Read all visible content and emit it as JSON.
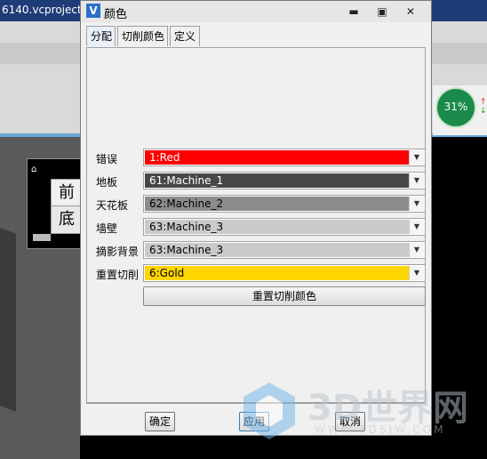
{
  "background": {
    "project_title": "6140.vcproject (",
    "nav_cube": {
      "top_face": "前",
      "bottom_face": "底"
    },
    "gauge_percent": "31%",
    "arrow_up": "↑",
    "arrow_down": "↓"
  },
  "dialog": {
    "icon": "V",
    "title": "颜色",
    "window_buttons": {
      "minimize": "▬",
      "maximize": "▣",
      "close": "✕"
    },
    "tabs": [
      {
        "label": "分配",
        "active": true
      },
      {
        "label": "切削颜色",
        "active": false
      },
      {
        "label": "定义",
        "active": false
      }
    ],
    "rows": [
      {
        "label": "错误",
        "value": "1:Red",
        "color": "#ff0000",
        "text_color": "#ffffff"
      },
      {
        "label": "地板",
        "value": "61:Machine_1",
        "color": "#474747",
        "text_color": "#ffffff"
      },
      {
        "label": "天花板",
        "value": "62:Machine_2",
        "color": "#8c8c8c",
        "text_color": "#000000"
      },
      {
        "label": "墙壁",
        "value": "63:Machine_3",
        "color": "#cacaca",
        "text_color": "#000000"
      },
      {
        "label": "摘影背景",
        "value": "63:Machine_3",
        "color": "#cacaca",
        "text_color": "#000000"
      },
      {
        "label": "重置切削",
        "value": "6:Gold",
        "color": "#ffd500",
        "text_color": "#000000"
      }
    ],
    "reset_button": "重置切削颜色",
    "buttons": {
      "ok": "确定",
      "apply": "应用",
      "cancel": "取消"
    }
  },
  "watermark": {
    "big": "3D世界网",
    "small": "WWW.3DSJW.COM"
  }
}
